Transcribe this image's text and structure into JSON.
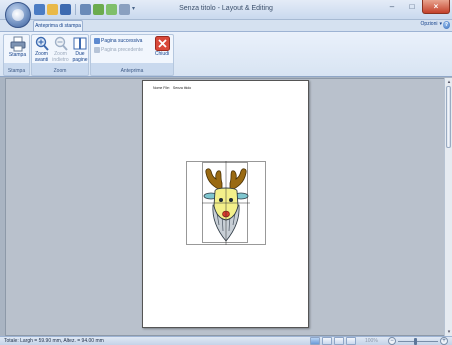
{
  "window": {
    "title": "Senza titolo - Layout & Editing",
    "minimize_glyph": "–",
    "maximize_glyph": "□",
    "close_glyph": "×"
  },
  "quick_access": {
    "icons": [
      "new-icon",
      "open-icon",
      "save-icon",
      "print-icon",
      "undo-icon",
      "redo-icon",
      "customize-icon"
    ],
    "icon_colors": [
      "#4b7cc4",
      "#e9b949",
      "#3d6ab0",
      "#6a8ab8",
      "#6bab4d",
      "#7fbf6a",
      "#8aa0c0"
    ],
    "dropdown_glyph": "▾"
  },
  "ribbon": {
    "active_tab": "Anteprima di stampa",
    "options_label": "Opzioni",
    "options_arrow": "▾",
    "help_glyph": "?",
    "groups": {
      "stampa": {
        "label": "Stampa",
        "buttons": {
          "print": "Stampa"
        }
      },
      "zoom": {
        "label": "Zoom",
        "buttons": {
          "zoom_in_line1": "Zoom",
          "zoom_in_line2": "avanti",
          "zoom_out_line1": "Zoom",
          "zoom_out_line2": "indietro",
          "two_pages_line1": "Due",
          "two_pages_line2": "pagine"
        }
      },
      "anteprima": {
        "label": "Anteprima",
        "buttons": {
          "next_page": "Pagina successiva",
          "prev_page": "Pagina precedente",
          "close": "Chiudi"
        }
      }
    }
  },
  "page": {
    "header_label": "Nome File:",
    "header_value": "Senza titolo"
  },
  "scrollbar": {
    "up_glyph": "▴",
    "down_glyph": "▾"
  },
  "statusbar": {
    "text": "Totale: Largh = 59.90 mm, Altez. = 94.00 mm",
    "zoom_value": "100%",
    "zoom_minus": "−",
    "zoom_plus": "+"
  },
  "colors": {
    "accent": "#15428b",
    "close_red": "#c4412b",
    "workarea": "#b9c1cc",
    "reindeer_antler": "#9a6a12",
    "reindeer_face": "#f3f08a",
    "reindeer_fur": "#c8cfd6",
    "reindeer_nose": "#d63a2a"
  }
}
